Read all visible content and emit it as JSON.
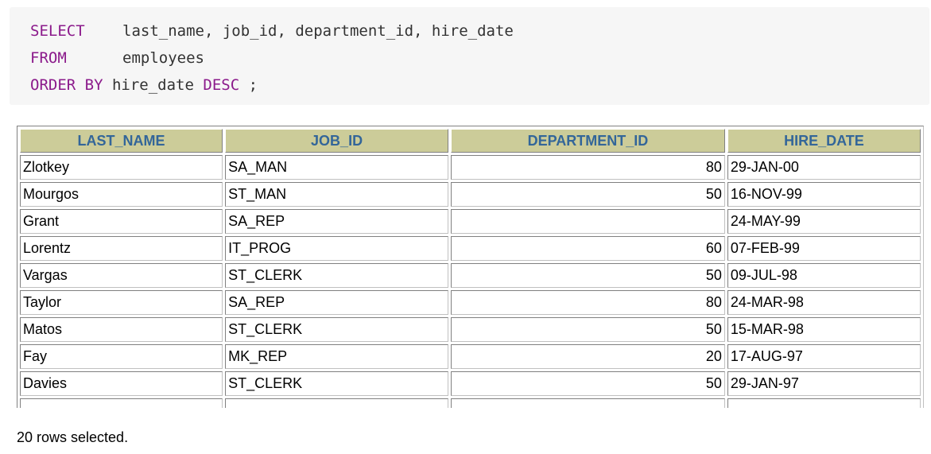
{
  "sql": {
    "lines": [
      {
        "keyword": "SELECT",
        "text": "last_name, job_id, department_id, hire_date"
      },
      {
        "keyword": "FROM",
        "text": "employees"
      },
      {
        "keyword": "ORDER BY",
        "text": "hire_date",
        "keyword2": "DESC",
        "tail": " ;"
      }
    ]
  },
  "table": {
    "headers": [
      "LAST_NAME",
      "JOB_ID",
      "DEPARTMENT_ID",
      "HIRE_DATE"
    ],
    "rows": [
      {
        "last_name": "Zlotkey",
        "job_id": "SA_MAN",
        "department_id": "80",
        "hire_date": "29-JAN-00"
      },
      {
        "last_name": "Mourgos",
        "job_id": "ST_MAN",
        "department_id": "50",
        "hire_date": "16-NOV-99"
      },
      {
        "last_name": "Grant",
        "job_id": "SA_REP",
        "department_id": "",
        "hire_date": "24-MAY-99"
      },
      {
        "last_name": "Lorentz",
        "job_id": "IT_PROG",
        "department_id": "60",
        "hire_date": "07-FEB-99"
      },
      {
        "last_name": "Vargas",
        "job_id": "ST_CLERK",
        "department_id": "50",
        "hire_date": "09-JUL-98"
      },
      {
        "last_name": "Taylor",
        "job_id": "SA_REP",
        "department_id": "80",
        "hire_date": "24-MAR-98"
      },
      {
        "last_name": "Matos",
        "job_id": "ST_CLERK",
        "department_id": "50",
        "hire_date": "15-MAR-98"
      },
      {
        "last_name": "Fay",
        "job_id": "MK_REP",
        "department_id": "20",
        "hire_date": "17-AUG-97"
      },
      {
        "last_name": "Davies",
        "job_id": "ST_CLERK",
        "department_id": "50",
        "hire_date": "29-JAN-97"
      },
      {
        "last_name": "",
        "job_id": "",
        "department_id": "",
        "hire_date": ""
      }
    ]
  },
  "status": "20 rows selected.",
  "colors": {
    "keyword": "#8b1a8b",
    "header_bg": "#cccc99",
    "header_text": "#336699",
    "code_bg": "#f6f6f6"
  }
}
